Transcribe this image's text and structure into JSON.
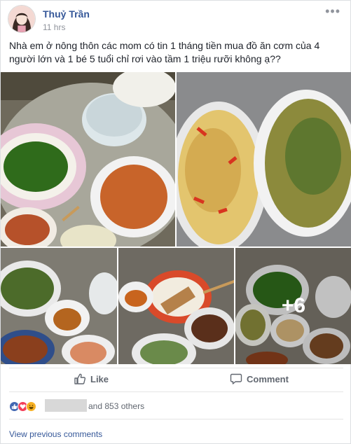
{
  "post": {
    "author": "Thuỷ Trần",
    "time": "11 hrs",
    "text": "Nhà em ở nông thôn các mom có tin 1 tháng tiền mua đồ ăn cơm của 4 người lớn và 1 bé 5 tuổi chỉ rơi vào tầm 1 triệu rưỡi không ạ??"
  },
  "photos": {
    "more_count": "+6"
  },
  "actions": {
    "like_label": "Like",
    "comment_label": "Comment"
  },
  "reactions": {
    "types": [
      "like-icon",
      "love-icon",
      "haha-icon"
    ],
    "others_text": "and 853 others"
  },
  "comments": {
    "view_previous": "View previous comments"
  },
  "colors": {
    "link": "#365899",
    "like": "#4267b2",
    "love": "#f33e58",
    "haha": "#f7b125",
    "muted": "#90949c"
  }
}
